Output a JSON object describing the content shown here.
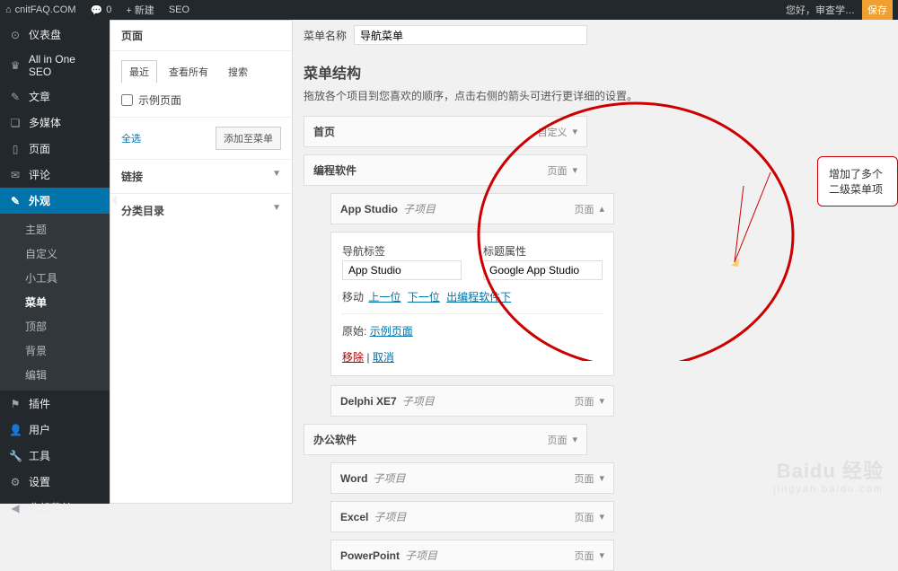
{
  "topbar": {
    "site": "cnitFAQ.COM",
    "comments": "0",
    "new": "+ 新建",
    "seo": "SEO",
    "greeting": "您好，审查学…",
    "save": "保存"
  },
  "sidebar": {
    "dashboard": "仪表盘",
    "aioseo": "All in One SEO",
    "posts": "文章",
    "media": "多媒体",
    "pages": "页面",
    "comments": "评论",
    "appearance": "外观",
    "submenu": {
      "themes": "主题",
      "customize": "自定义",
      "widgets": "小工具",
      "menus": "菜单",
      "header": "顶部",
      "background": "背景",
      "editor": "编辑"
    },
    "plugins": "插件",
    "users": "用户",
    "tools": "工具",
    "settings": "设置",
    "collapse": "收起菜单"
  },
  "pages_panel": {
    "title": "页面",
    "tabs": {
      "recent": "最近",
      "viewall": "查看所有",
      "search": "搜索"
    },
    "sample": "示例页面",
    "select_all": "全选",
    "add": "添加至菜单",
    "links": "链接",
    "categories": "分类目录"
  },
  "content": {
    "menu_name_label": "菜单名称",
    "menu_name_value": "导航菜单",
    "struct_title": "菜单结构",
    "struct_desc": "拖放各个项目到您喜欢的顺序，点击右侧的箭头可进行更详细的设置。",
    "items": [
      {
        "title": "首页",
        "type": "自定义"
      },
      {
        "title": "编程软件",
        "type": "页面"
      },
      {
        "title": "App Studio",
        "sub": "子项目",
        "type": "页面"
      },
      {
        "title": "Delphi XE7",
        "sub": "子项目",
        "type": "页面"
      },
      {
        "title": "办公软件",
        "type": "页面"
      },
      {
        "title": "Word",
        "sub": "子项目",
        "type": "页面"
      },
      {
        "title": "Excel",
        "sub": "子项目",
        "type": "页面"
      },
      {
        "title": "PowerPoint",
        "sub": "子项目",
        "type": "页面"
      }
    ],
    "expanded": {
      "nav_label_l": "导航标签",
      "nav_label_v": "App Studio",
      "title_l": "标题属性",
      "title_v": "Google App Studio",
      "move": "移动",
      "up": "上一位",
      "down": "下一位",
      "out": "出编程软件下",
      "orig": "原始:",
      "orig_link": "示例页面",
      "remove": "移除",
      "cancel": "取消"
    }
  },
  "callout": "增加了多个二级菜单项",
  "watermark": {
    "brand": "Baidu 经验",
    "url": "jingyan.baidu.com"
  }
}
